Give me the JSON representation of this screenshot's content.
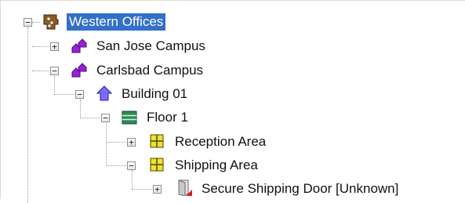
{
  "tree": {
    "nodes": [
      {
        "label": "Western Offices",
        "expanded": true,
        "selected": true,
        "icon": "region-icon"
      },
      {
        "label": "San Jose Campus",
        "expanded": false,
        "icon": "campus-icon"
      },
      {
        "label": "Carlsbad Campus",
        "expanded": true,
        "icon": "campus-icon"
      },
      {
        "label": "Building 01",
        "expanded": true,
        "icon": "building-icon"
      },
      {
        "label": "Floor 1",
        "expanded": true,
        "icon": "floor-icon"
      },
      {
        "label": "Reception Area",
        "expanded": false,
        "icon": "area-icon"
      },
      {
        "label": "Shipping Area",
        "expanded": true,
        "icon": "area-icon"
      },
      {
        "label": "Secure Shipping Door [Unknown]",
        "expanded": false,
        "icon": "door-icon"
      }
    ],
    "colors": {
      "selection": "#3370c8",
      "campus": "#9b1fd6",
      "building": "#7b6cff",
      "floor": "#2e8b57",
      "area": "#f0e030"
    }
  }
}
